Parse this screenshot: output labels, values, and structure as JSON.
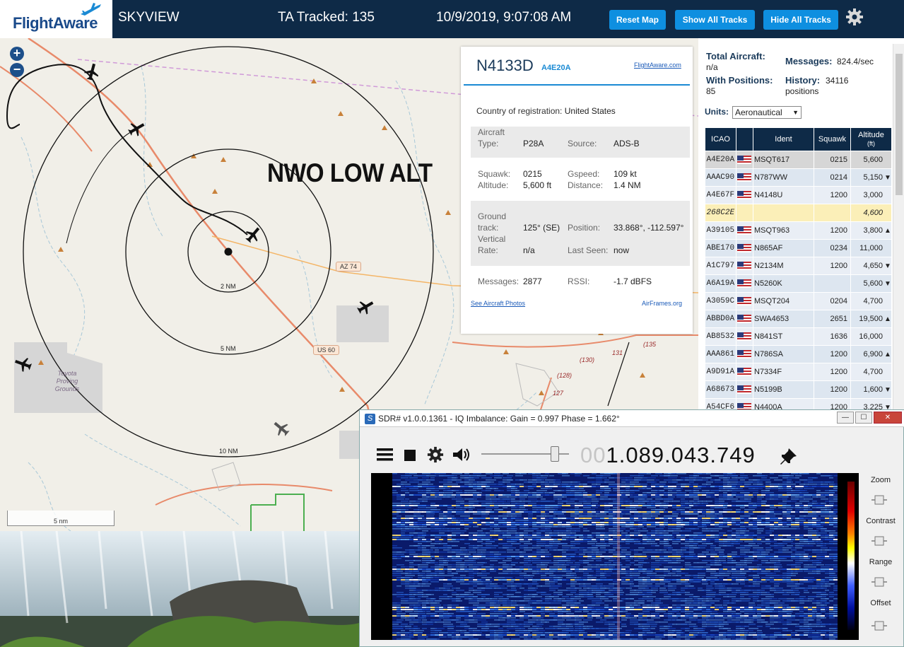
{
  "header": {
    "logo": "FlightAware",
    "app_name": "SKYVIEW",
    "ta_tracked": "TA Tracked: 135",
    "datetime": "10/9/2019, 9:07:08 AM",
    "buttons": {
      "reset_map": "Reset Map",
      "show_all_tracks": "Show All Tracks",
      "hide_all_tracks": "Hide All Tracks"
    }
  },
  "map": {
    "overlay_title": "NWO LOW ALT",
    "rings": [
      "2 NM",
      "5 NM",
      "10 NM"
    ],
    "roads": [
      "AZ 74",
      "US 60"
    ],
    "highways": [
      "(135",
      "(130)",
      "131",
      "(128)",
      "127"
    ],
    "place": "Toyota Proving Grounds",
    "scale": "5 nm"
  },
  "selected": {
    "registration": "N4133D",
    "icao": "A4E20A",
    "flightaware_link": "FlightAware.com",
    "country_label": "Country of registration:",
    "country": "United States",
    "aircraft_type_label": "Aircraft Type:",
    "aircraft_type_label_1": "Aircraft",
    "aircraft_type_label_2": "Type:",
    "aircraft_type": "P28A",
    "source_label": "Source:",
    "source": "ADS-B",
    "squawk_label": "Squawk:",
    "squawk": "0215",
    "gspeed_label": "Gspeed:",
    "gspeed": "109 kt",
    "altitude_label": "Altitude:",
    "altitude": "5,600 ft",
    "distance_label": "Distance:",
    "distance": "1.4 NM",
    "ground_track_label_1": "Ground",
    "ground_track_label_2": "track:",
    "ground_track": "125° (SE)",
    "position_label": "Position:",
    "position": "33.868°, -112.597°",
    "vertical_rate_label_1": "Vertical",
    "vertical_rate_label_2": "Rate:",
    "vertical_rate": "n/a",
    "last_seen_label": "Last Seen:",
    "last_seen": "now",
    "messages_label": "Messages:",
    "messages": "2877",
    "rssi_label": "RSSI:",
    "rssi": "-1.7 dBFS",
    "photos_link": "See Aircraft Photos",
    "airframes_link": "AirFrames.org"
  },
  "stats": {
    "total_aircraft_label": "Total Aircraft:",
    "total_aircraft": "n/a",
    "messages_label": "Messages:",
    "messages": "824.4/sec",
    "with_positions_label": "With Positions:",
    "with_positions": "85",
    "history_label": "History:",
    "history_1": "34116",
    "history_2": "positions",
    "units_label": "Units:",
    "units_value": "Aeronautical"
  },
  "table": {
    "headers": {
      "icao": "ICAO",
      "ident": "Ident",
      "squawk": "Squawk",
      "altitude_1": "Altitude",
      "altitude_2": "(ft)"
    },
    "rows": [
      {
        "icao": "A4E20A",
        "flag": true,
        "ident": "MSQT617",
        "squawk": "0215",
        "alt": "5,600",
        "trend": ""
      },
      {
        "icao": "AAAC90",
        "flag": true,
        "ident": "N787WW",
        "squawk": "0214",
        "alt": "5,150",
        "trend": "▼"
      },
      {
        "icao": "A4E67F",
        "flag": true,
        "ident": "N4148U",
        "squawk": "1200",
        "alt": "3,000",
        "trend": ""
      },
      {
        "icao": "268C2E",
        "flag": false,
        "ident": "",
        "squawk": "",
        "alt": "4,600",
        "trend": ""
      },
      {
        "icao": "A39105",
        "flag": true,
        "ident": "MSQT963",
        "squawk": "1200",
        "alt": "3,800",
        "trend": "▲"
      },
      {
        "icao": "ABE170",
        "flag": true,
        "ident": "N865AF",
        "squawk": "0234",
        "alt": "11,000",
        "trend": ""
      },
      {
        "icao": "A1C797",
        "flag": true,
        "ident": "N2134M",
        "squawk": "1200",
        "alt": "4,650",
        "trend": "▼"
      },
      {
        "icao": "A6A19A",
        "flag": true,
        "ident": "N5260K",
        "squawk": "",
        "alt": "5,600",
        "trend": "▼"
      },
      {
        "icao": "A3059C",
        "flag": true,
        "ident": "MSQT204",
        "squawk": "0204",
        "alt": "4,700",
        "trend": ""
      },
      {
        "icao": "ABBD0A",
        "flag": true,
        "ident": "SWA4653",
        "squawk": "2651",
        "alt": "19,500",
        "trend": "▲"
      },
      {
        "icao": "AB8532",
        "flag": true,
        "ident": "N841ST",
        "squawk": "1636",
        "alt": "16,000",
        "trend": ""
      },
      {
        "icao": "AAA861",
        "flag": true,
        "ident": "N786SA",
        "squawk": "1200",
        "alt": "6,900",
        "trend": "▲"
      },
      {
        "icao": "A9D91A",
        "flag": true,
        "ident": "N7334F",
        "squawk": "1200",
        "alt": "4,700",
        "trend": ""
      },
      {
        "icao": "A68673",
        "flag": true,
        "ident": "N5199B",
        "squawk": "1200",
        "alt": "1,600",
        "trend": "▼"
      },
      {
        "icao": "A54CF6",
        "flag": true,
        "ident": "N4400A",
        "squawk": "1200",
        "alt": "3,225",
        "trend": "▼"
      }
    ]
  },
  "sdr": {
    "title": "SDR# v1.0.0.1361 - IQ Imbalance: Gain = 0.997 Phase = 1.662°",
    "freq_dim": "00",
    "freq": "1.089.043.749",
    "labels": {
      "zoom": "Zoom",
      "contrast": "Contrast",
      "range": "Range",
      "offset": "Offset"
    }
  },
  "colors": {
    "header_bg": "#0e2a47",
    "button": "#0e8fe0",
    "accent": "#1a8ad4"
  }
}
